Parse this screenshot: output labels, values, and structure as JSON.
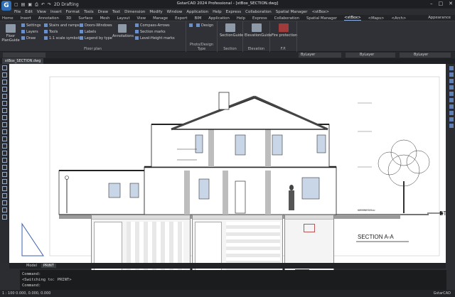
{
  "app": {
    "title": "GstarCAD 2024 Professional - [stBox_SECTION.dwg]",
    "logo_letter": "G",
    "workspace": "2D Drafting",
    "brand": "GstarCAD"
  },
  "menubar": [
    "File",
    "Edit",
    "View",
    "Insert",
    "Format",
    "Tools",
    "Draw",
    "Text",
    "Dimension",
    "Modify",
    "Window",
    "Application",
    "Help",
    "Express",
    "Collaboration",
    "Spatial Manager",
    "<stBox>"
  ],
  "tabs": [
    {
      "label": "Home"
    },
    {
      "label": "Insert"
    },
    {
      "label": "Annotation"
    },
    {
      "label": "3D"
    },
    {
      "label": "Surface"
    },
    {
      "label": "Mesh"
    },
    {
      "label": "Layout"
    },
    {
      "label": "View"
    },
    {
      "label": "Manage"
    },
    {
      "label": "Export"
    },
    {
      "label": "BIM"
    },
    {
      "label": "Application"
    },
    {
      "label": "Help"
    },
    {
      "label": "Express"
    },
    {
      "label": "Collaboration"
    },
    {
      "label": "Spatial Manager"
    },
    {
      "label": "<stBox>",
      "active": true
    },
    {
      "label": "<Maps>"
    },
    {
      "label": "<Arch>"
    }
  ],
  "appearance_label": "Appearance",
  "ribbon": {
    "floor_plan": {
      "title": "Floor plan",
      "floor_guide": "Floor PlanGuide",
      "settings": "Settings",
      "layers": "Layers",
      "draw": "Draw",
      "stairs": "Stairs and ramps",
      "tools": "Tools",
      "scale": "1:1 scale symbols",
      "doors": "Doors-Windows",
      "labels": "Labels",
      "legend": "Legend by type",
      "annotations": "Annotations",
      "compass": "Compass-Arrows",
      "section_marks": "Section marks",
      "level_marks": "Level-Height marks"
    },
    "photo": {
      "title": "Photo/Design Type",
      "design": "Design"
    },
    "section": {
      "title": "Section",
      "guide": "SectionGuide"
    },
    "elevation": {
      "title": "Elevation",
      "guide": "ElevationGuide"
    },
    "fp": {
      "title": "F.P.",
      "fire": "Fire protection"
    }
  },
  "propbar": {
    "layer1": "ByLayer",
    "layer2": "ByLayer",
    "layer3": "ByLayer"
  },
  "document_tab": "stBox_SECTION.dwg",
  "drawing": {
    "section_title": "SECTION A-A",
    "st_label": "ST",
    "ground_label": "GROUND FLOOR"
  },
  "layout_tabs": [
    {
      "label": "Model"
    },
    {
      "label": "PRINT",
      "active": true
    }
  ],
  "command": {
    "lines": [
      "Command:",
      "<Switching to: PRINT>",
      "Command:"
    ]
  },
  "status": {
    "coords": "1 : 100  0.000, 0.000, 0.000"
  },
  "colors": {
    "accent": "#2f6db5",
    "background": "#2b2d30",
    "canvas": "#ffffff"
  }
}
